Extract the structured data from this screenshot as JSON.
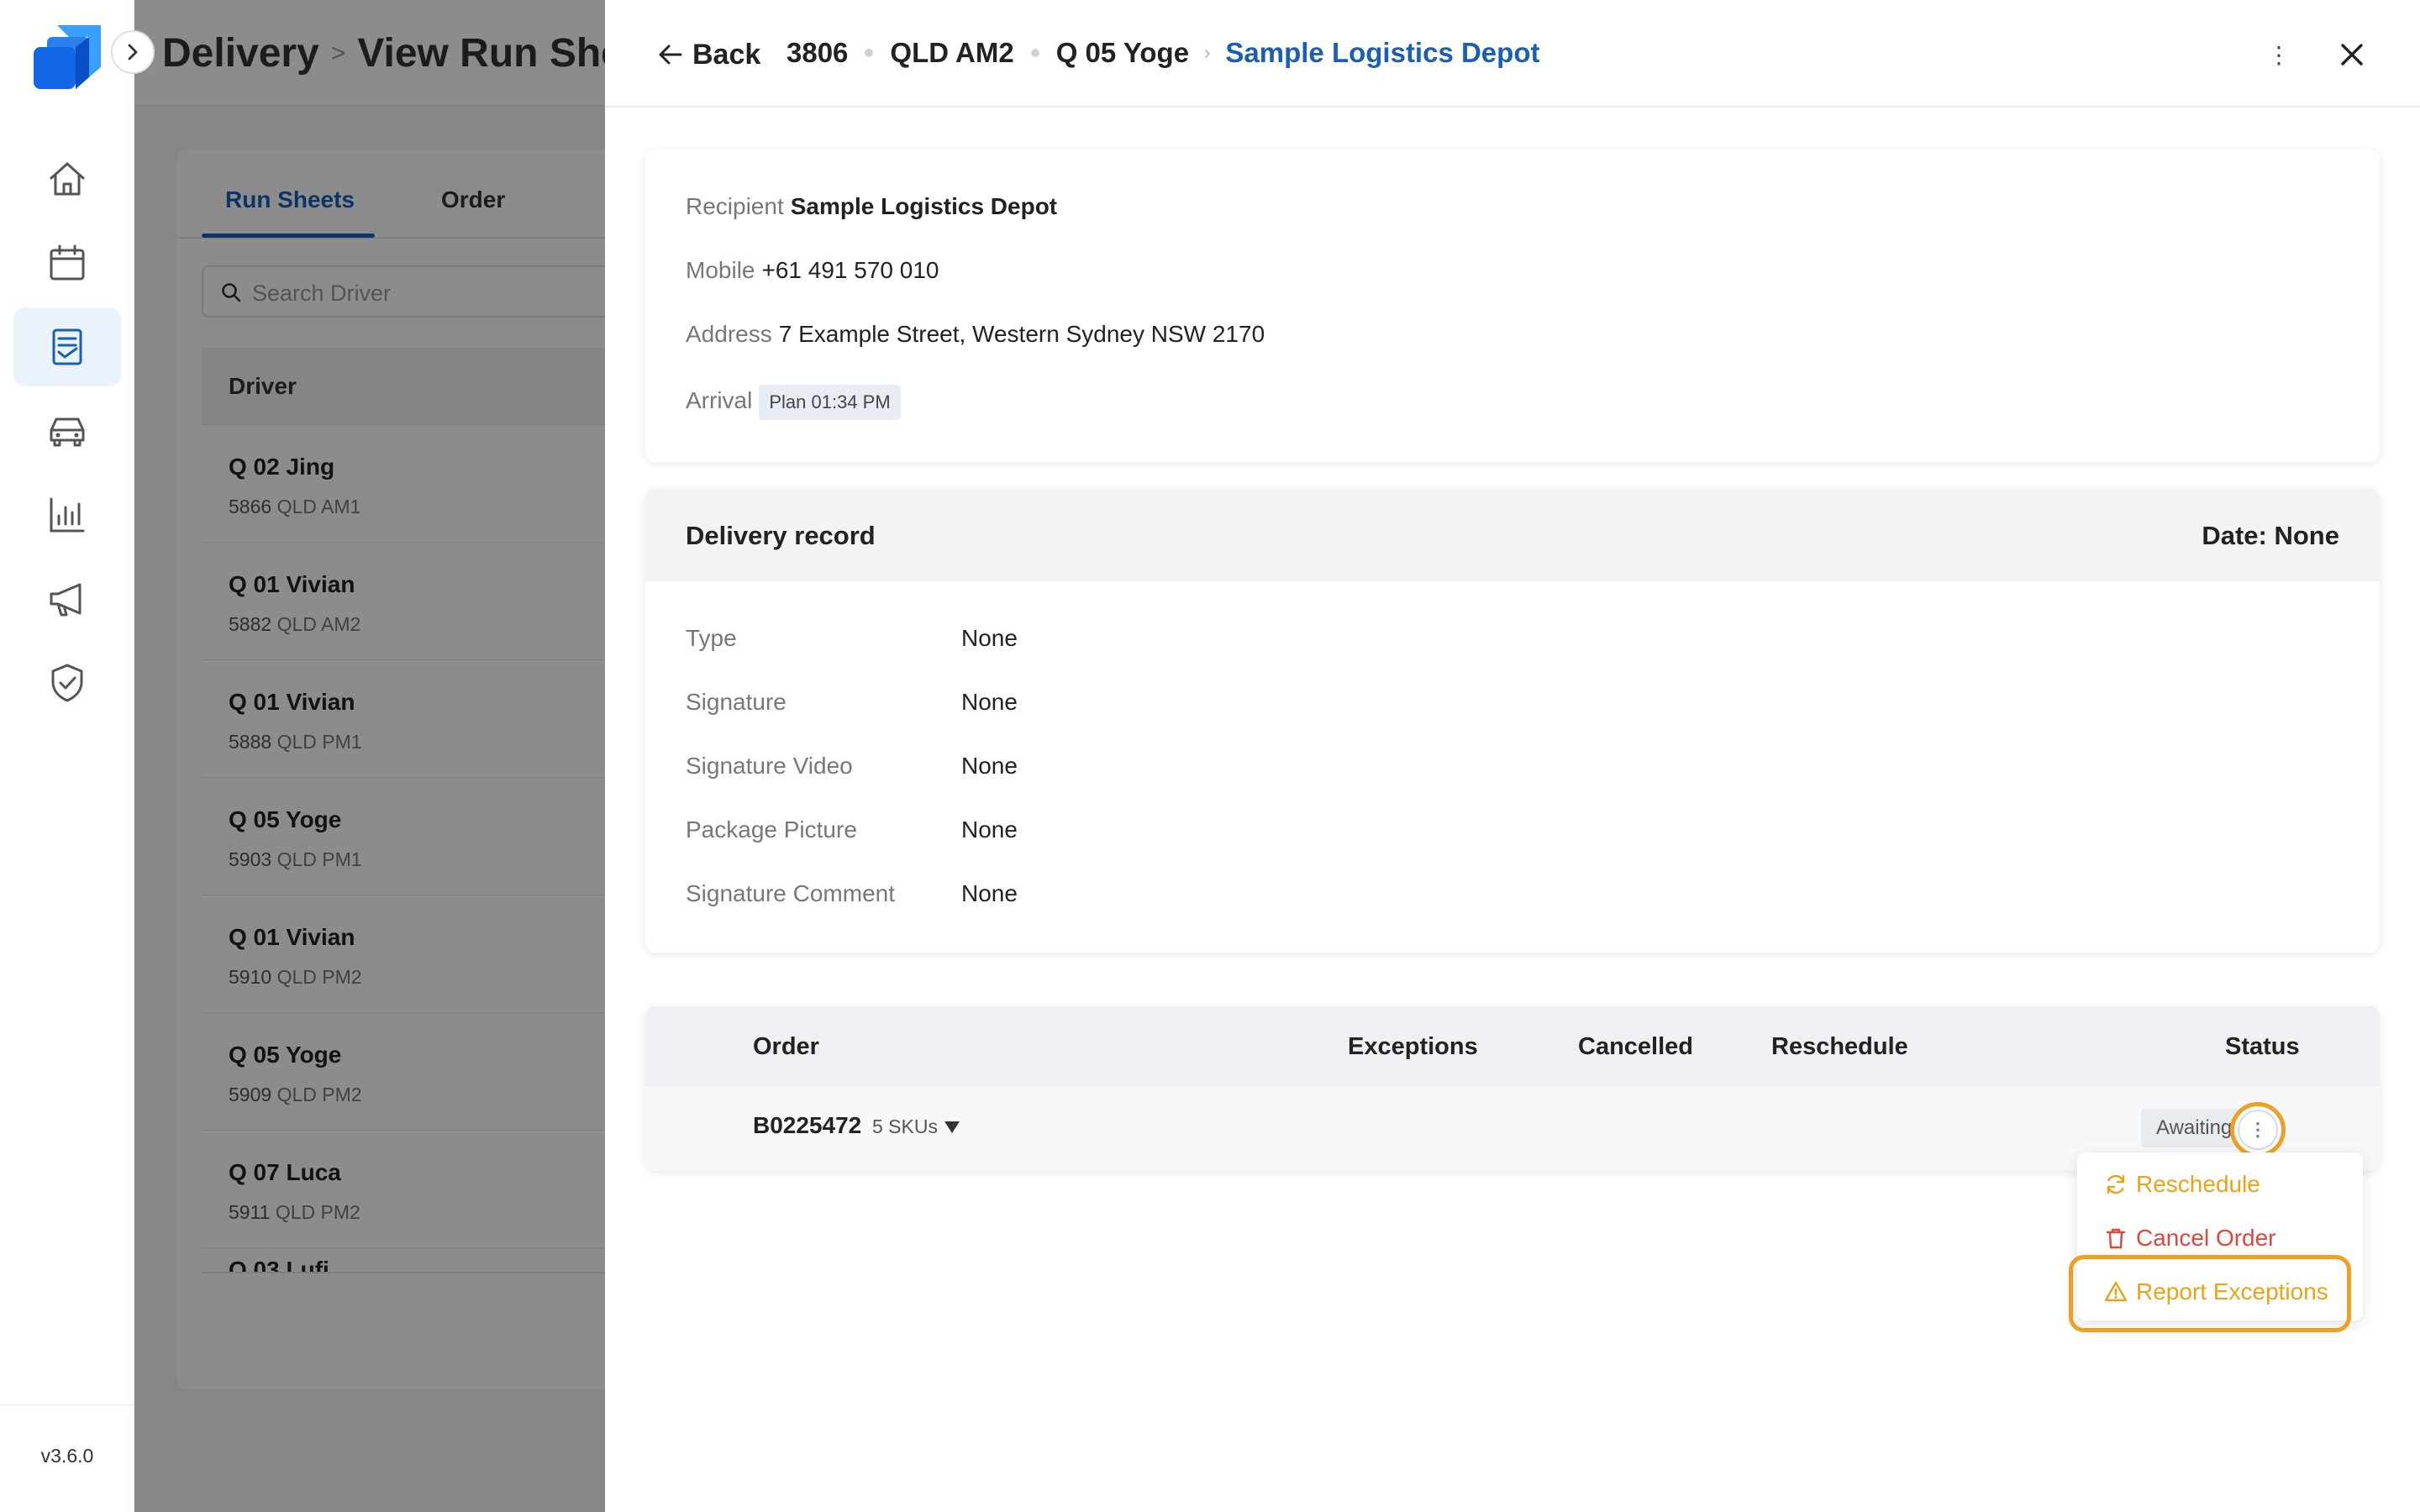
{
  "app": {
    "version": "v3.6.0",
    "accent_color": "#1a5fb4",
    "highlight_color": "#f0a020"
  },
  "rail": {
    "items": [
      {
        "icon": "home-icon",
        "active": false
      },
      {
        "icon": "calendar-icon",
        "active": false
      },
      {
        "icon": "run-sheet-icon",
        "active": true
      },
      {
        "icon": "vehicle-icon",
        "active": false
      },
      {
        "icon": "bar-chart-icon",
        "active": false
      },
      {
        "icon": "megaphone-icon",
        "active": false
      },
      {
        "icon": "shield-check-icon",
        "active": false
      }
    ]
  },
  "background": {
    "title": "Delivery",
    "subtitle": "View Run She",
    "tabs": [
      "Run Sheets",
      "Order"
    ],
    "search_placeholder": "Search Driver",
    "table_header": "Driver",
    "drivers": [
      {
        "name": "Q 02 Jing",
        "number": "5866",
        "run": "QLD AM1"
      },
      {
        "name": "Q 01 Vivian",
        "number": "5882",
        "run": "QLD AM2"
      },
      {
        "name": "Q 01 Vivian",
        "number": "5888",
        "run": "QLD PM1"
      },
      {
        "name": "Q 05 Yoge",
        "number": "5903",
        "run": "QLD PM1"
      },
      {
        "name": "Q 01 Vivian",
        "number": "5910",
        "run": "QLD PM2"
      },
      {
        "name": "Q 05 Yoge",
        "number": "5909",
        "run": "QLD PM2"
      },
      {
        "name": "Q 07 Luca",
        "number": "5911",
        "run": "QLD PM2"
      }
    ]
  },
  "drawer": {
    "back_label": "Back",
    "breadcrumb": [
      "3806",
      "QLD AM2",
      "Q 05 Yoge",
      "Sample Logistics Depot"
    ],
    "recipient": {
      "recipient_label": "Recipient",
      "recipient_value": "Sample Logistics Depot",
      "mobile_label": "Mobile",
      "mobile_value": "+61 491 570 010",
      "address_label": "Address",
      "address_value": "7 Example Street, Western Sydney NSW 2170",
      "arrival_label": "Arrival",
      "arrival_value": "Plan 01:34 PM"
    },
    "delivery_record": {
      "title": "Delivery record",
      "date": "Date: None",
      "rows": [
        {
          "label": "Type",
          "value": "None"
        },
        {
          "label": "Signature",
          "value": "None"
        },
        {
          "label": "Signature Video",
          "value": "None"
        },
        {
          "label": "Package Picture",
          "value": "None"
        },
        {
          "label": "Signature Comment",
          "value": "None"
        }
      ]
    },
    "orders": {
      "columns": [
        "Order",
        "Exceptions",
        "Cancelled",
        "Reschedule",
        "Status"
      ],
      "rows": [
        {
          "order": "B0225472",
          "skus": "5 SKUs",
          "exceptions": "",
          "cancelled": "",
          "reschedule": "",
          "status": "Awaiting"
        }
      ]
    },
    "action_menu": {
      "items": [
        {
          "label": "Reschedule",
          "icon": "refresh-icon",
          "color": "#e8a317"
        },
        {
          "label": "Cancel Order",
          "icon": "trash-icon",
          "color": "#e2453c"
        },
        {
          "label": "Report Exceptions",
          "icon": "warning-icon",
          "color": "#e8a317"
        }
      ]
    }
  }
}
